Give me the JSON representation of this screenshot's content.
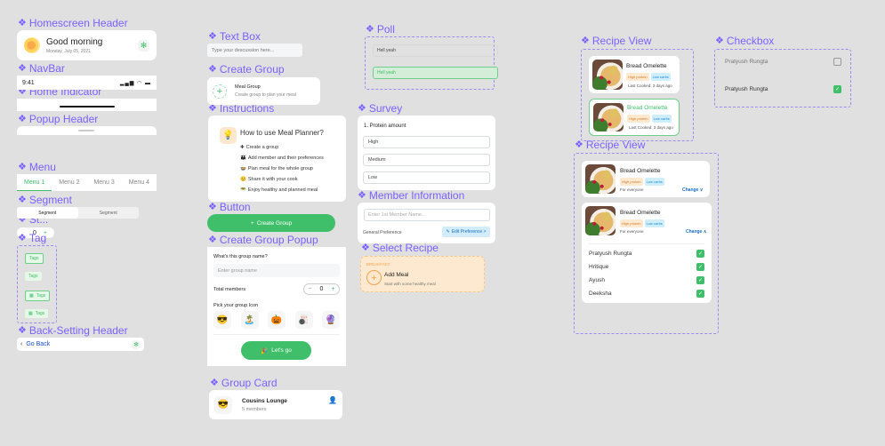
{
  "labels": {
    "homescreen_header": "Homescreen Header",
    "navbar": "NavBar",
    "home_indicator": "Home Indicator",
    "popup_header": "Popup Header",
    "menu": "Menu",
    "segment": "Segment",
    "stepper": "St...",
    "tag": "Tag",
    "back_setting_header": "Back-Setting Header",
    "text_box": "Text Box",
    "create_group": "Create Group",
    "instructions": "Instructions",
    "button": "Button",
    "create_group_popup": "Create Group Popup",
    "group_card": "Group Card",
    "poll": "Poll",
    "survey": "Survey",
    "member_information": "Member Information",
    "select_recipe": "Select Recipe",
    "recipe_view": "Recipe View",
    "checkbox": "Checkbox"
  },
  "homescreen_header": {
    "greeting": "Good morning",
    "date": "Monday, July 05, 2021",
    "icon": "sun-icon",
    "settings_icon": "gear-icon"
  },
  "navbar": {
    "time": "9:41",
    "signal": "signal-icon",
    "wifi": "wifi-icon",
    "battery": "battery-icon"
  },
  "menu": {
    "items": [
      "Menu 1",
      "Menu 2",
      "Menu 3",
      "Menu 4"
    ],
    "active": "Menu 1"
  },
  "segment": {
    "items": [
      "Segment",
      "Segment"
    ],
    "active_index": 0
  },
  "stepper_small": {
    "value": "0",
    "plus": "+"
  },
  "tags": [
    "Tags",
    "Tags",
    "Tags",
    "Tags"
  ],
  "back_header": {
    "label": "Go Back",
    "chevron": "‹"
  },
  "text_box": {
    "placeholder": "Type your descussion here..."
  },
  "create_group": {
    "title": "Meal Group",
    "subtitle": "Create group to plan your meal"
  },
  "instructions": {
    "title": "How to use Meal Planner?",
    "steps": [
      {
        "icon": "✚",
        "text": "Create a group"
      },
      {
        "icon": "👪",
        "text": "Add member and their preferences"
      },
      {
        "icon": "🍲",
        "text": "Plan meal for the whole group"
      },
      {
        "icon": "😊",
        "text": "Share it with your cook"
      },
      {
        "icon": "🥗",
        "text": "Enjoy healthy and planned meal"
      }
    ]
  },
  "button": {
    "label": "Create Group",
    "icon": "+"
  },
  "create_group_popup": {
    "question": "What's this group name?",
    "placeholder": "Enter group name",
    "total_members_label": "Total members",
    "members_value": "0",
    "minus": "−",
    "plus": "+",
    "pick_icon_label": "Pick your group Icon",
    "icons": [
      "😎",
      "🏝️",
      "🎃",
      "🎳",
      "🔮"
    ],
    "submit_label": "Let's go",
    "submit_icon": "🎉"
  },
  "group_card": {
    "icon": "😎",
    "name": "Cousins Lounge",
    "members": "5 members"
  },
  "poll": {
    "options": [
      {
        "text": "Hell yeah",
        "selected": false
      },
      {
        "text": "Hell yeah",
        "selected": true
      }
    ]
  },
  "survey": {
    "question": "1. Protein amount",
    "options": [
      "High",
      "Medium",
      "Low"
    ]
  },
  "member_information": {
    "placeholder": "Enter 1st Member Name...",
    "general_preference": "General Preference",
    "edit_label": "Edit Preference >"
  },
  "select_recipe": {
    "meal_type": "BREAKFAST",
    "title": "Add Meal",
    "subtitle": "Start with some healthy meal"
  },
  "recipe_view_1": {
    "cards": [
      {
        "title": "Bread Omelette",
        "tags": [
          "High protein",
          "Low carbs"
        ],
        "sub": "Last Cooked: 3 days ago",
        "selected": false
      },
      {
        "title": "Bread Omelette",
        "tags": [
          "High protein",
          "Low carbs"
        ],
        "sub": "Last Cooked: 3 days ago",
        "selected": true
      }
    ]
  },
  "recipe_view_2": {
    "cards": [
      {
        "title": "Bread Omelette",
        "tags": [
          "High protein",
          "Low carbs"
        ],
        "sub": "For everyone",
        "change": "Change ∨"
      },
      {
        "title": "Bread Omelette",
        "tags": [
          "High protein",
          "Low carbs"
        ],
        "sub": "For everyone",
        "change": "Change ∧"
      }
    ],
    "people": [
      {
        "name": "Pratyush Rungta",
        "checked": true
      },
      {
        "name": "Hritique",
        "checked": true
      },
      {
        "name": "Ayush",
        "checked": true
      },
      {
        "name": "Deeksha",
        "checked": true
      }
    ]
  },
  "checkbox": {
    "items": [
      {
        "name": "Pratyush Rungta",
        "checked": false
      },
      {
        "name": "Pratyush Rungta",
        "checked": true
      }
    ]
  },
  "colors": {
    "accent_green": "#3fbf6a",
    "label_purple": "#7b61ff",
    "link_blue": "#1a6fc4",
    "orange": "#f3a24a"
  }
}
